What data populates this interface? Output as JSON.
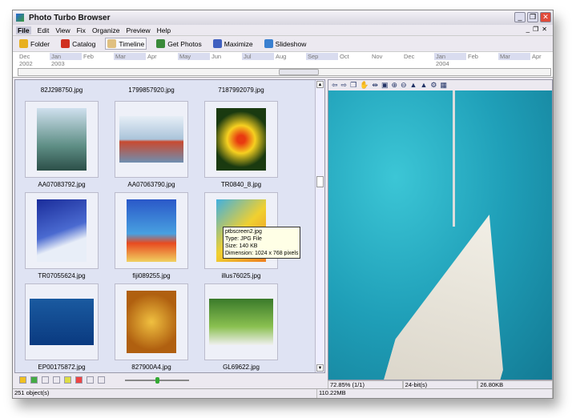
{
  "app": {
    "title": "Photo Turbo Browser"
  },
  "menu": [
    "File",
    "Edit",
    "View",
    "Fix",
    "Organize",
    "Preview",
    "Help"
  ],
  "toolbar": [
    {
      "label": "Folder",
      "color": "#e8b020"
    },
    {
      "label": "Catalog",
      "color": "#d03020"
    },
    {
      "label": "Timeline",
      "color": "#e0c080"
    },
    {
      "label": "Get Photos",
      "color": "#3a8a3a"
    },
    {
      "label": "Maximize",
      "color": "#4060c0"
    },
    {
      "label": "Slideshow",
      "color": "#3a80d0"
    }
  ],
  "timeline": {
    "months": [
      "Dec",
      "Jan",
      "Feb",
      "Mar",
      "Apr",
      "May",
      "Jun",
      "Jul",
      "Aug",
      "Sep",
      "Oct",
      "Nov",
      "Dec",
      "Jan",
      "Feb",
      "Mar",
      "Apr"
    ],
    "years": [
      "2002",
      "2003",
      "2004"
    ]
  },
  "thumbs_top": [
    "82J298750.jpg",
    "1799857920.jpg",
    "7187992079.jpg"
  ],
  "thumbs": [
    {
      "name": "AA07083792.jpg",
      "bg": "linear-gradient(#cfe0ee,#5f8f86 60%,#2c4f48)"
    },
    {
      "name": "AA07063790.jpg",
      "bg": "linear-gradient(#e6eef6,#aac4da 50%,#c84a30 55%,#6f8fb0)"
    },
    {
      "name": "TR0840_8.jpg",
      "bg": "radial-gradient(circle,#e83a10 10%,#f6d020 35%,#1a3a10 70%)"
    },
    {
      "name": "TR07055624.jpg",
      "bg": "linear-gradient(160deg,#1a2c9a,#4a6ad0 50%,#e8eef8 70%)"
    },
    {
      "name": "fiji089255.jpg",
      "bg": "linear-gradient(#2a58c8,#48a0e0 55%,#e84a20 70%,#f0d060)"
    },
    {
      "name": "illus76025.jpg",
      "bg": "linear-gradient(135deg,#40b0e0,#f0d030 50%,#f08020)"
    },
    {
      "name": "EP00175872.jpg",
      "bg": "linear-gradient(#1a5aa0,#0a3a80)"
    },
    {
      "name": "827900A4.jpg",
      "bg": "radial-gradient(circle,#f0c040,#b06010 70%)"
    },
    {
      "name": "GL69622.jpg",
      "bg": "linear-gradient(#3a7a2a,#8ac050 60%,#f0f0f0)"
    }
  ],
  "tooltip": [
    "ptbscreen2.jpg",
    "Type: JPG File",
    "Size: 140 KB",
    "Dimension: 1024 x 768 pixels"
  ],
  "preview_tools": [
    "⇦",
    "⇨",
    "❐",
    "✋",
    "⇹",
    "▣",
    "⊕",
    "⊖",
    "▲",
    "▲",
    "⚙",
    "▦"
  ],
  "preview_status": {
    "zoom": "72.85% (1/1)",
    "depth": "24-bit(s)",
    "size": "26.80KB"
  },
  "status": {
    "objects": "251 object(s)",
    "memory": "110.22MB"
  }
}
